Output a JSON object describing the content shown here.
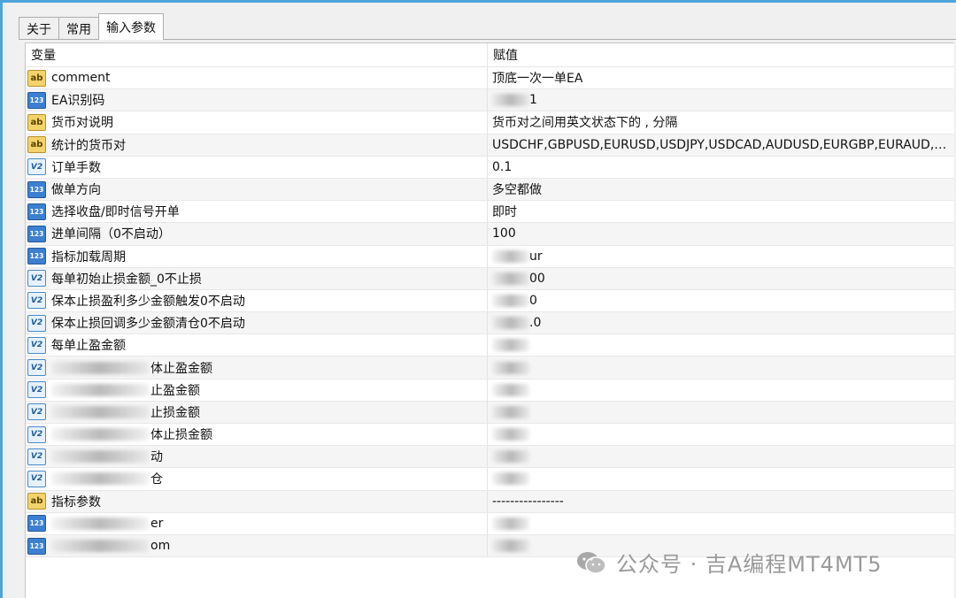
{
  "tabs": [
    "关于",
    "常用",
    "输入参数"
  ],
  "active_tab": 2,
  "table": {
    "headers": {
      "variable": "变量",
      "value": "赋值"
    },
    "rows": [
      {
        "type": "string",
        "icon": "ab",
        "name": "comment",
        "value": "顶底一次一单EA"
      },
      {
        "type": "int",
        "icon": "123",
        "name": "EA识别码",
        "value": "1",
        "redacted_value": true
      },
      {
        "type": "string",
        "icon": "ab",
        "name": "货币对说明",
        "value": "货币对之间用英文状态下的 , 分隔"
      },
      {
        "type": "string",
        "icon": "ab",
        "name": "统计的货币对",
        "value": "USDCHF,GBPUSD,EURUSD,USDJPY,USDCAD,AUDUSD,EURGBP,EURAUD,EURCHF,EURJPY"
      },
      {
        "type": "double",
        "icon": "V2",
        "name": "订单手数",
        "value": "0.1"
      },
      {
        "type": "int",
        "icon": "123",
        "name": "做单方向",
        "value": "多空都做"
      },
      {
        "type": "int",
        "icon": "123",
        "name": "选择收盘/即时信号开单",
        "value": "即时"
      },
      {
        "type": "int",
        "icon": "123",
        "name": "进单间隔（0不启动）",
        "value": "100"
      },
      {
        "type": "int",
        "icon": "123",
        "name": "指标加载周期",
        "value": "ur",
        "redacted_value": true
      },
      {
        "type": "double",
        "icon": "V2",
        "name": "每单初始止损金额_0不止损",
        "value": "00",
        "redacted_value": true
      },
      {
        "type": "double",
        "icon": "V2",
        "name": "保本止损盈利多少金额触发0不启动",
        "value": "0",
        "redacted_value": true
      },
      {
        "type": "double",
        "icon": "V2",
        "name": "保本止损回调多少金额清仓0不启动",
        "value": ".0",
        "redacted_value": true
      },
      {
        "type": "double",
        "icon": "V2",
        "name": "每单止盈金额",
        "value": "",
        "redacted_value": true
      },
      {
        "type": "double",
        "icon": "V2",
        "name": "体止盈金额",
        "value": "",
        "redacted_name": true,
        "redacted_value": true
      },
      {
        "type": "double",
        "icon": "V2",
        "name": "止盈金额",
        "value": "",
        "redacted_name": true,
        "redacted_value": true
      },
      {
        "type": "double",
        "icon": "V2",
        "name": "止损金额",
        "value": "",
        "redacted_name": true,
        "redacted_value": true
      },
      {
        "type": "double",
        "icon": "V2",
        "name": "体止损金额",
        "value": "",
        "redacted_name": true,
        "redacted_value": true
      },
      {
        "type": "double",
        "icon": "V2",
        "name": "动",
        "value": "",
        "redacted_name": true,
        "redacted_value": true
      },
      {
        "type": "double",
        "icon": "V2",
        "name": "仓",
        "value": "",
        "redacted_name": true,
        "redacted_value": true
      },
      {
        "type": "string",
        "icon": "ab",
        "name": "指标参数",
        "value": "----------------"
      },
      {
        "type": "int",
        "icon": "123",
        "name": "er",
        "value": "",
        "redacted_name": true,
        "redacted_value": true
      },
      {
        "type": "int",
        "icon": "123",
        "name": "om",
        "value": "",
        "redacted_name": true,
        "redacted_value": true
      }
    ]
  },
  "watermark": {
    "text": "公众号 · 吉A编程MT4MT5",
    "icon": "wechat-icon",
    "color": "#9a9a9a"
  },
  "colors": {
    "window_border": "#4da3dc",
    "string_icon": "#f3d36b",
    "int_icon": "#3d7fd0",
    "double_icon": "#e6f1fb"
  }
}
